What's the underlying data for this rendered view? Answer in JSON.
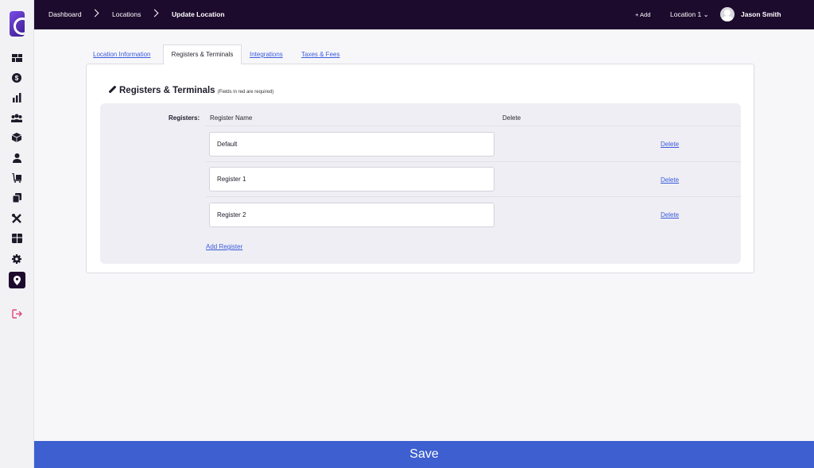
{
  "sidebar": {
    "items": [
      {
        "name": "dashboard-icon",
        "glyph": "▪▪"
      },
      {
        "name": "dollar-icon",
        "glyph": "$"
      },
      {
        "name": "bar-chart-icon",
        "glyph": "▮"
      },
      {
        "name": "customers-icon",
        "glyph": "●"
      },
      {
        "name": "box-icon",
        "glyph": "◆"
      },
      {
        "name": "user-icon",
        "glyph": "●"
      },
      {
        "name": "dolly-icon",
        "glyph": "▣"
      },
      {
        "name": "copy-icon",
        "glyph": "❐"
      },
      {
        "name": "tools-icon",
        "glyph": "✕"
      },
      {
        "name": "gift-icon",
        "glyph": "⊞"
      },
      {
        "name": "gear-icon",
        "glyph": "⚙"
      },
      {
        "name": "location-pin-icon",
        "glyph": "◉"
      },
      {
        "name": "logout-icon",
        "glyph": "⇥"
      }
    ]
  },
  "topbar": {
    "breadcrumbs": [
      "Dashboard",
      "Locations",
      "Update Location"
    ],
    "add_label": "+ Add",
    "location_label": "Location 1 ⌄",
    "user_name": "Jason Smith"
  },
  "tabs": [
    "Location Information",
    "Registers & Terminals",
    "Integrations",
    "Taxes & Fees"
  ],
  "section": {
    "title": "Registers & Terminals",
    "note": "(Fields in red are required)"
  },
  "registers": {
    "label": "Registers:",
    "col_name": "Register Name",
    "col_delete": "Delete",
    "rows": [
      {
        "name": "Default",
        "delete_label": "Delete"
      },
      {
        "name": "Register 1",
        "delete_label": "Delete"
      },
      {
        "name": "Register 2",
        "delete_label": "Delete"
      }
    ],
    "add_label": "Add Register"
  },
  "save_label": "Save",
  "colors": {
    "topbar": "#1d0b2e",
    "accent": "#3d5fd0",
    "link": "#3b5bdb"
  }
}
